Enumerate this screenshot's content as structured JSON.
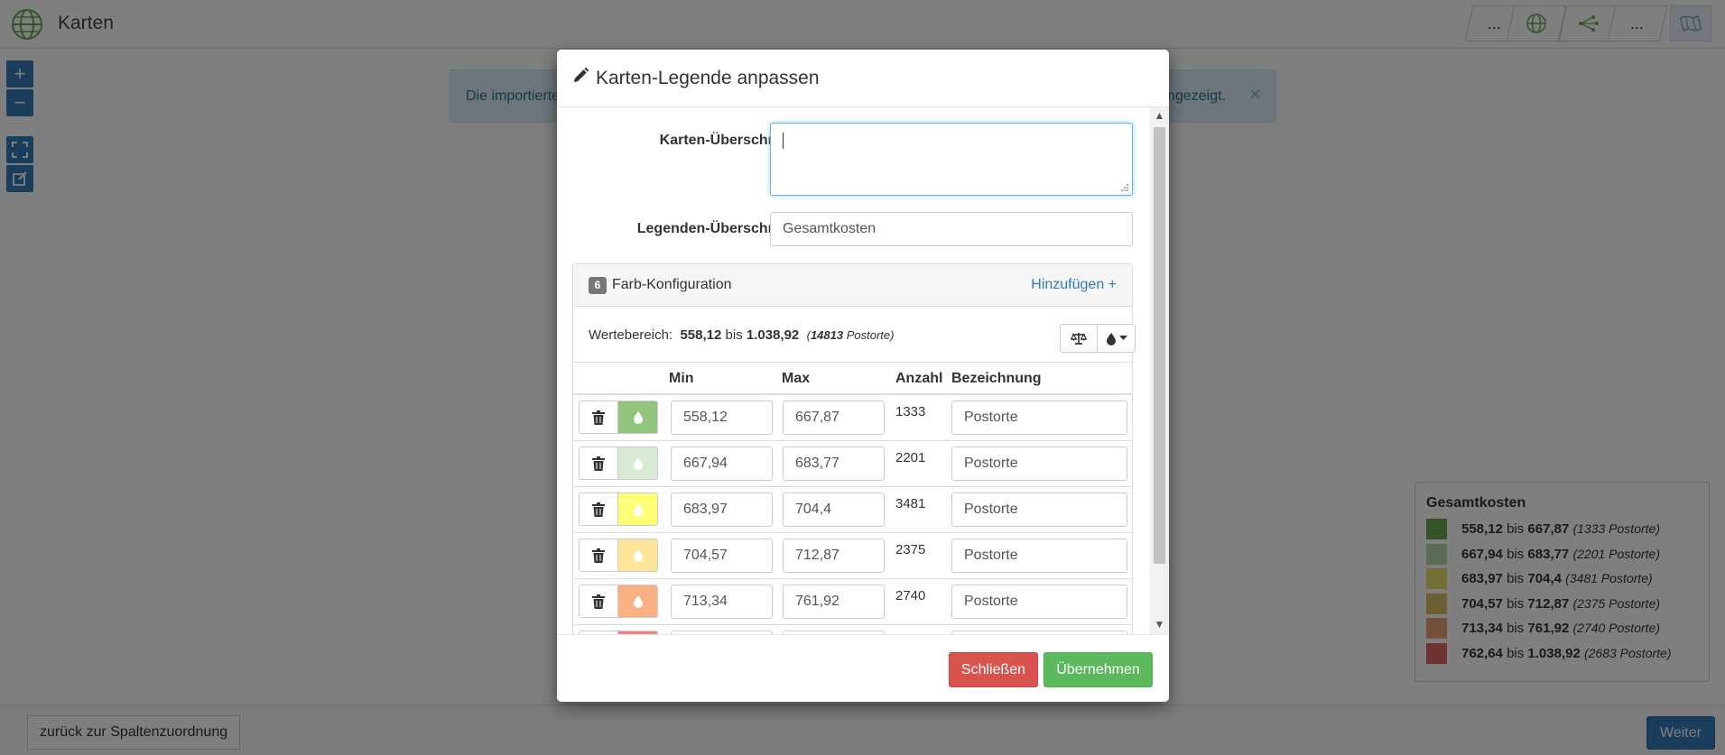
{
  "app": {
    "title": "Karten",
    "top_buttons": [
      "...",
      "globe-icon",
      "network-icon",
      "...",
      "map-icon"
    ]
  },
  "map_controls": {
    "zoom_in": "+",
    "zoom_out": "−"
  },
  "alert": {
    "text_start": "Die importierte",
    "text_end": "ngezeigt.",
    "close": "×"
  },
  "legend": {
    "title": "Gesamtkosten",
    "entries": [
      {
        "color": "#6aa84f",
        "min": "558,12",
        "sep": "bis",
        "max": "667,87",
        "note": "(1333 Postorte)"
      },
      {
        "color": "#b6d7a8",
        "min": "667,94",
        "sep": "bis",
        "max": "683,77",
        "note": "(2201 Postorte)"
      },
      {
        "color": "#e8e06a",
        "min": "683,97",
        "sep": "bis",
        "max": "704,4",
        "note": "(3481 Postorte)"
      },
      {
        "color": "#d6c36a",
        "min": "704,57",
        "sep": "bis",
        "max": "712,87",
        "note": "(2375 Postorte)"
      },
      {
        "color": "#e9a07a",
        "min": "713,34",
        "sep": "bis",
        "max": "761,92",
        "note": "(2740 Postorte)"
      },
      {
        "color": "#e06666",
        "min": "762,64",
        "sep": "bis",
        "max": "1.038,92",
        "note": "(2683 Postorte)"
      }
    ]
  },
  "bottom": {
    "back_label": "zurück zur Spaltenzuordnung",
    "next_label": "Weiter"
  },
  "modal": {
    "title": "Karten-Legende anpassen",
    "map_heading_label": "Karten-Überschrift",
    "map_heading_value": "",
    "legend_heading_label": "Legenden-Überschrift",
    "legend_heading_value": "Gesamtkosten",
    "panel": {
      "badge": "6",
      "title": "Farb-Konfiguration",
      "add_label": "Hinzufügen +",
      "range_label": "Wertebereich:",
      "range_min": "558,12",
      "range_sep": "bis",
      "range_max": "1.038,92",
      "range_count": "14813",
      "range_unit": "Postorte",
      "columns": {
        "min": "Min",
        "max": "Max",
        "count": "Anzahl",
        "label": "Bezeichnung"
      },
      "rows": [
        {
          "color": "#93c47d",
          "min": "558,12",
          "max": "667,87",
          "count": "1333",
          "label": "Postorte"
        },
        {
          "color": "#d9ead3",
          "min": "667,94",
          "max": "683,77",
          "count": "2201",
          "label": "Postorte"
        },
        {
          "color": "#ffff77",
          "min": "683,97",
          "max": "704,4",
          "count": "3481",
          "label": "Postorte"
        },
        {
          "color": "#ffe599",
          "min": "704,57",
          "max": "712,87",
          "count": "2375",
          "label": "Postorte"
        },
        {
          "color": "#f9b183",
          "min": "713,34",
          "max": "761,92",
          "count": "2740",
          "label": "Postorte"
        },
        {
          "color": "#f08080",
          "min": "",
          "max": "",
          "count": "",
          "label": ""
        }
      ]
    },
    "close_label": "Schließen",
    "apply_label": "Übernehmen"
  }
}
